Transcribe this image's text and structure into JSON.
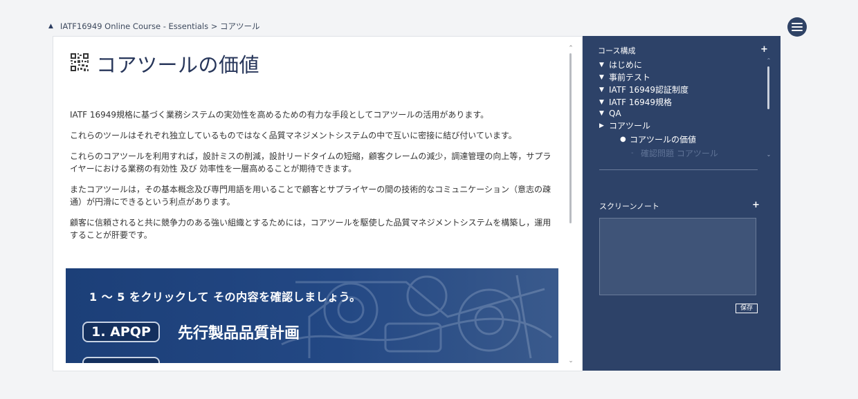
{
  "breadcrumb": {
    "toggle_icon": "triangle-up-icon",
    "text": "IATF16949 Online Course - Essentials > コアツール"
  },
  "header": {
    "menu_icon": "hamburger-menu-icon"
  },
  "main": {
    "title_icon": "qr-code-icon",
    "title": "コアツールの価値",
    "paragraphs": [
      "IATF 16949規格に基づく業務システムの実効性を高めるための有力な手段としてコアツールの活用があります。",
      "これらのツールはそれぞれ独立しているものではなく品質マネジメントシステムの中で互いに密接に結び付いています。",
      "これらのコアツールを利用すれば，設計ミスの削減，設計リードタイムの短縮，顧客クレームの減少，調達管理の向上等，サプライヤーにおける業務の有効性 及び 効率性を一層高めることが期待できます。",
      "またコアツールは，その基本概念及び専門用語を用いることで顧客とサプライヤーの間の技術的なコミュニケーション（意志の疎通）が円滑にできるという利点があります。",
      "顧客に信頼されると共に競争力のある強い組織とするためには，コアツールを駆使した品質マネジメントシステムを構築し，運用することが肝要です。"
    ],
    "banner": {
      "instruction": "1 ～ 5 をクリックして その内容を確認しましょう。",
      "items": [
        {
          "button": "1. APQP",
          "label": "先行製品品質計画"
        }
      ]
    }
  },
  "sidebar": {
    "course_heading": "コース構成",
    "course_add": "+",
    "toc": [
      {
        "marker": "▼",
        "label": "はじめに"
      },
      {
        "marker": "▼",
        "label": "事前テスト"
      },
      {
        "marker": "▼",
        "label": "IATF 16949認証制度"
      },
      {
        "marker": "▼",
        "label": "IATF 16949規格"
      },
      {
        "marker": "▼",
        "label": "QA"
      },
      {
        "marker": "▶",
        "label": "コアツール"
      },
      {
        "marker": "●",
        "label": "コアツールの価値"
      },
      {
        "marker": "-",
        "label": "確認問題 コアツール"
      }
    ],
    "notes_heading": "スクリーンノート",
    "notes_add": "+",
    "notes_value": "",
    "save_label": "保存"
  },
  "colors": {
    "sidebar_bg": "#2d4268",
    "title": "#27365a",
    "banner_bg": "#1c3f78"
  }
}
